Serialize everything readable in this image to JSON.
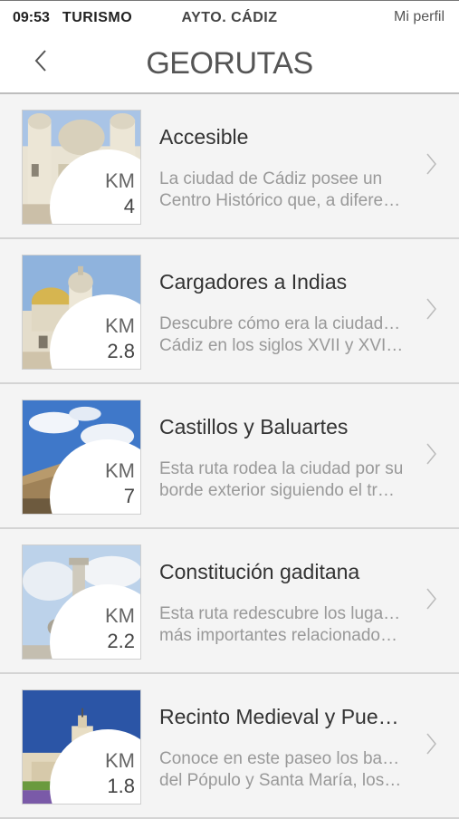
{
  "statusbar": {
    "time": "09:53",
    "section": "TURISMO",
    "center": "AYTO. CÁDIZ",
    "profile": "Mi perfil"
  },
  "header": {
    "title": "GEORUTAS",
    "back_icon": "chevron-left-icon"
  },
  "routes": [
    {
      "title": "Accesible",
      "desc_line1": "La ciudad de Cádiz posee un",
      "desc_line2": "Centro Histórico que, a diferen…",
      "km_label": "KM",
      "km": "4",
      "image": "cathedral-photo"
    },
    {
      "title": "Cargadores a Indias",
      "desc_line1": "Descubre cómo era la ciudad de",
      "desc_line2": "Cádiz en los siglos XVII y XVIII…",
      "km_label": "KM",
      "km": "2.8",
      "image": "domes-photo"
    },
    {
      "title": "Castillos y Baluartes",
      "desc_line1": "Esta ruta rodea la ciudad por su",
      "desc_line2": "borde exterior siguiendo el tra…",
      "km_label": "KM",
      "km": "7",
      "image": "fortress-wall-photo"
    },
    {
      "title": "Constitución gaditana",
      "desc_line1": "Esta ruta redescubre los lugares",
      "desc_line2": "más importantes relacionados…",
      "km_label": "KM",
      "km": "2.2",
      "image": "monument-photo"
    },
    {
      "title": "Recinto Medieval y Puert…",
      "desc_line1": "Conoce en este paseo los barrios",
      "desc_line2": "del Pópulo y Santa María, los…",
      "km_label": "KM",
      "km": "1.8",
      "image": "town-hall-photo"
    }
  ],
  "colors": {
    "row_bg": "#f4f4f4",
    "title": "#333333",
    "desc": "#999999",
    "chevron": "#bbbbbb"
  }
}
